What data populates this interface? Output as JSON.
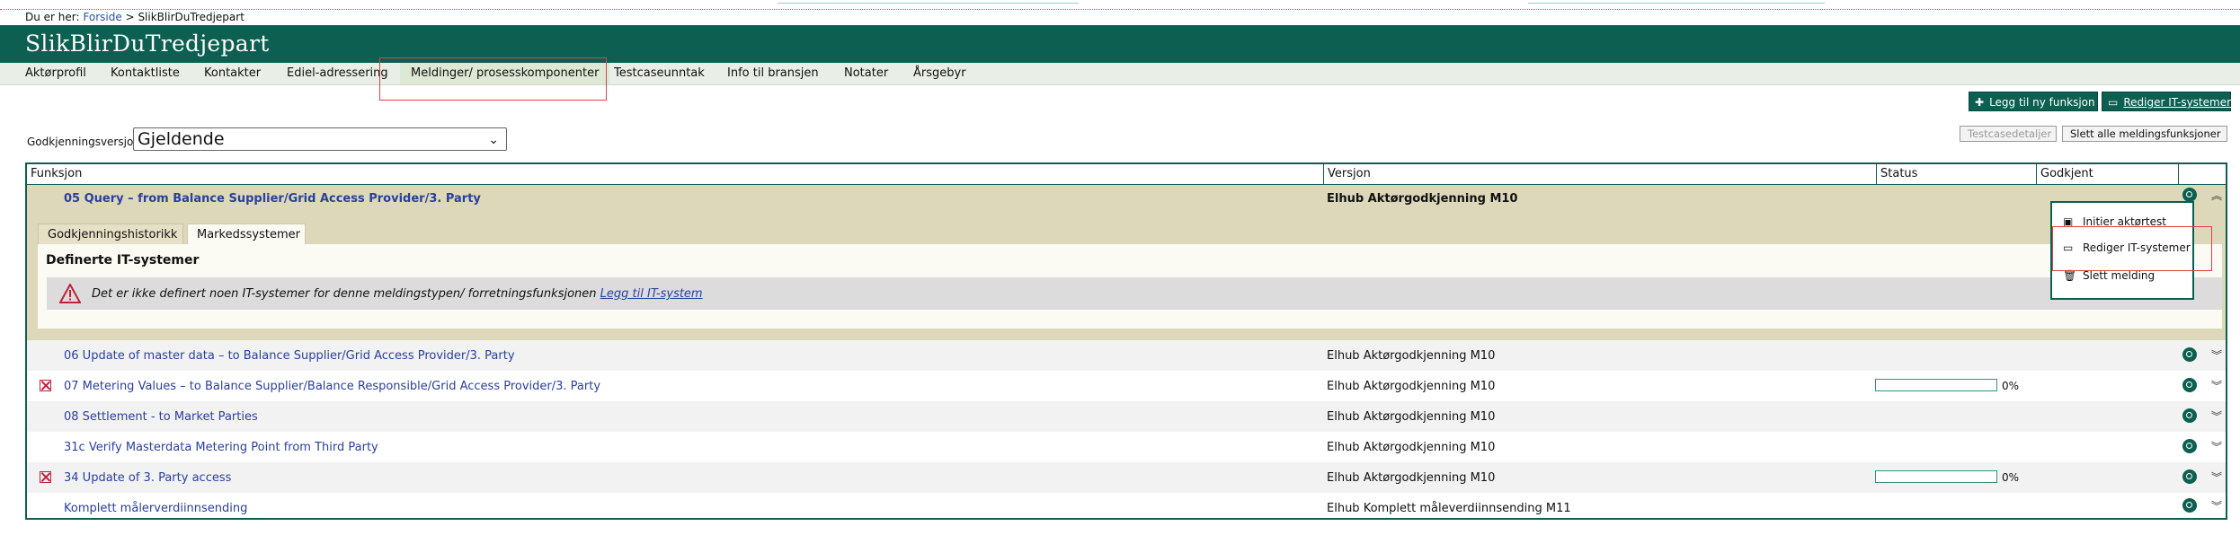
{
  "breadcrumb": {
    "prefix": "Du er her:",
    "home": "Forside",
    "separator": ">",
    "current": "SlikBlirDuTredjepart"
  },
  "banner": {
    "title": "SlikBlirDuTredjepart"
  },
  "nav": [
    {
      "label": "Aktørprofil"
    },
    {
      "label": "Kontaktliste"
    },
    {
      "label": "Kontakter"
    },
    {
      "label": "Ediel-adressering"
    },
    {
      "label": "Meldinger/ prosesskomponenter"
    },
    {
      "label": "Testcaseunntak"
    },
    {
      "label": "Info til bransjen"
    },
    {
      "label": "Notater"
    },
    {
      "label": "Årsgebyr"
    }
  ],
  "actions": {
    "add_function": "Legg til ny funksjon",
    "edit_it": "Rediger IT-systemer",
    "testcase_details": "Testcasedetaljer",
    "delete_all": "Slett alle meldingsfunksjoner"
  },
  "version_select": {
    "label": "Godkjenningsversjon",
    "value": "Gjeldende"
  },
  "table": {
    "headers": {
      "function": "Funksjon",
      "version": "Versjon",
      "status": "Status",
      "approved": "Godkjent"
    },
    "expanded": {
      "function": "05 Query – from Balance Supplier/Grid Access Provider/3. Party",
      "version": "Elhub Aktørgodkjenning M10",
      "tabs": [
        "Godkjenningshistorikk",
        "Markedssystemer"
      ],
      "panel_heading": "Definerte IT-systemer",
      "warning_text": "Det er ikke definert noen IT-systemer for denne meldingstypen/ forretningsfunksjonen",
      "warning_link": "Legg til IT-system"
    },
    "rows": [
      {
        "function": "06 Update of master data – to Balance Supplier/Grid Access Provider/3. Party",
        "version": "Elhub Aktørgodkjenning M10"
      },
      {
        "function": "07 Metering Values – to Balance Supplier/Balance Responsible/Grid Access Provider/3. Party",
        "version": "Elhub Aktørgodkjenning M10",
        "progress": "0%"
      },
      {
        "function": "08 Settlement - to Market Parties",
        "version": "Elhub Aktørgodkjenning M10"
      },
      {
        "function": "31c Verify Masterdata Metering Point from Third Party",
        "version": "Elhub Aktørgodkjenning M10"
      },
      {
        "function": "34 Update of 3. Party access",
        "version": "Elhub Aktørgodkjenning M10",
        "progress": "0%"
      },
      {
        "function": "Komplett målerverdiinnsending",
        "version": "Elhub Komplett måleverdiinnsending M11"
      }
    ]
  },
  "context_menu": {
    "items": [
      "Initier aktørtest",
      "Rediger IT-systemer",
      "Slett melding"
    ]
  },
  "colors": {
    "brand": "#0d5f51",
    "highlight": "#e0424a",
    "expanded_bg": "#ddd8b9"
  }
}
